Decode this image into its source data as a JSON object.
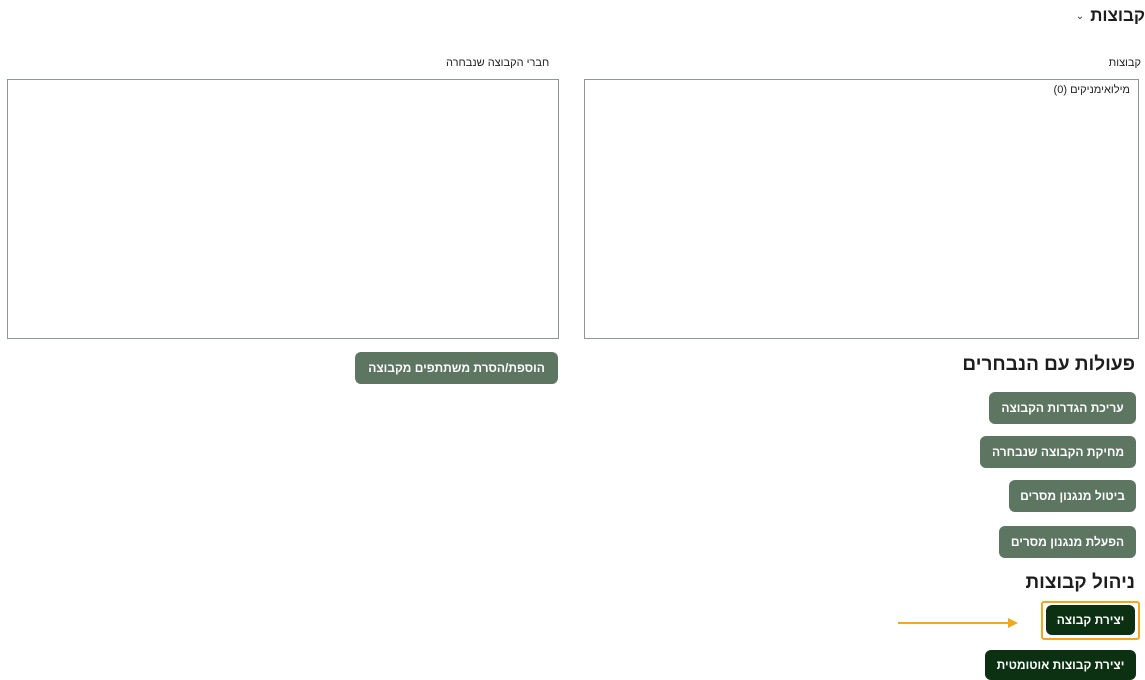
{
  "groups_section": {
    "title": "קבוצות",
    "chevron_icon": "chevron-down-icon"
  },
  "groups_list": {
    "label": "קבוצות",
    "options": [
      "מילואימניקים (0)"
    ]
  },
  "members_list": {
    "label": "חברי הקבוצה שנבחרה"
  },
  "members_actions": {
    "add_remove_label": "הוספת/הסרת משתתפים מקבוצה"
  },
  "selected_actions": {
    "title": "פעולות עם הנבחרים",
    "edit_label": "עריכת הגדרות הקבוצה",
    "delete_label": "מחיקת הקבוצה שנבחרה",
    "disable_messaging_label": "ביטול מנגנון מסרים",
    "enable_messaging_label": "הפעלת מנגנון מסרים"
  },
  "manage_groups": {
    "title": "ניהול קבוצות",
    "create_label": "יצירת קבוצה",
    "auto_create_label": "יצירת קבוצות אוטומטית"
  },
  "colors": {
    "muted_button": "#5d7662",
    "dark_button": "#0c3112",
    "highlight": "#f1a81d"
  }
}
